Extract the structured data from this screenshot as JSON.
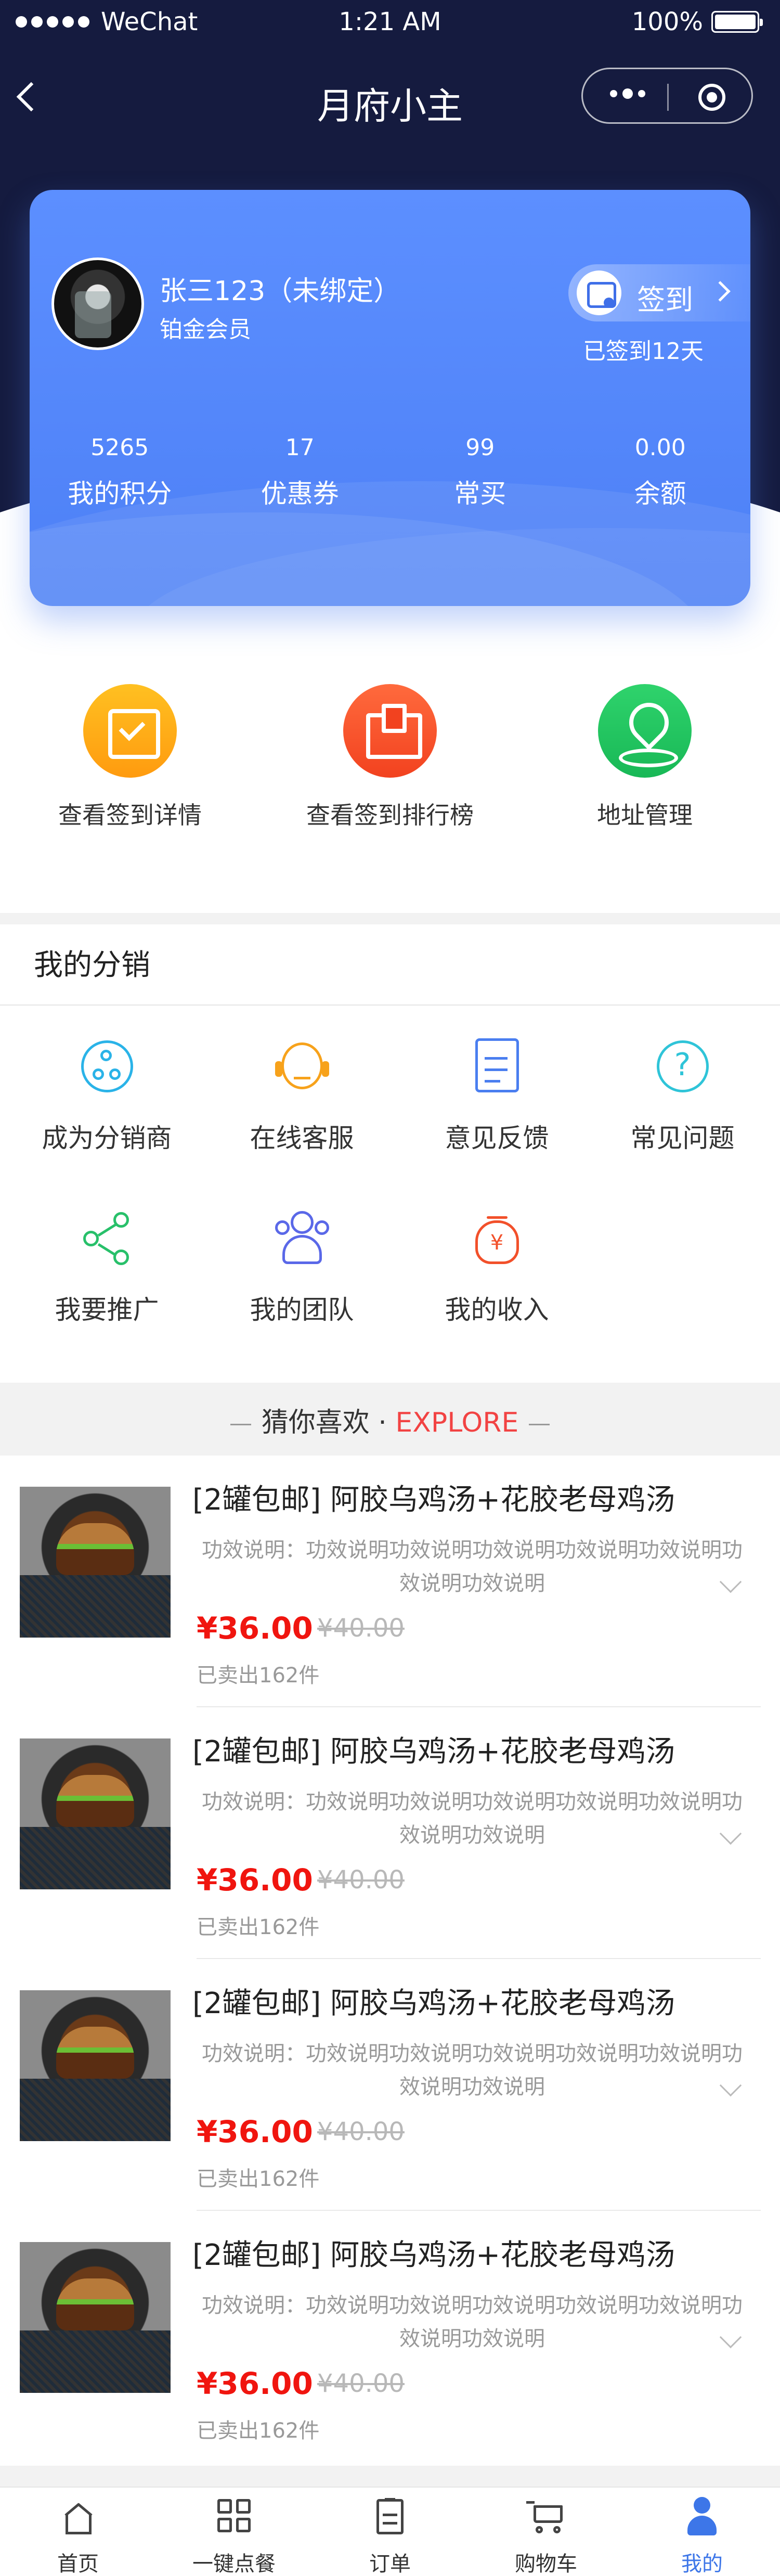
{
  "status_bar": {
    "carrier": "WeChat",
    "time": "1:21 AM",
    "battery": "100%"
  },
  "nav": {
    "title": "月府小主"
  },
  "member_card": {
    "name": "张三123（未绑定）",
    "level": "铂金会员",
    "checkin_label": "签到",
    "checkin_status": "已签到12天",
    "stats": [
      {
        "value": "5265",
        "label": "我的积分"
      },
      {
        "value": "17",
        "label": "优惠券"
      },
      {
        "value": "99",
        "label": "常买"
      },
      {
        "value": "0.00",
        "label": "余额"
      }
    ]
  },
  "shortcuts": [
    {
      "label": "查看签到详情",
      "icon": "calendar-check-icon",
      "color": "#ffb01a"
    },
    {
      "label": "查看签到排行榜",
      "icon": "podium-icon",
      "color": "#f2502a"
    },
    {
      "label": "地址管理",
      "icon": "location-pin-icon",
      "color": "#22c460"
    }
  ],
  "distribution": {
    "title": "我的分销",
    "items": [
      {
        "label": "成为分销商",
        "icon": "network-icon",
        "color": "#2ab3e8"
      },
      {
        "label": "在线客服",
        "icon": "customer-service-icon",
        "color": "#f7a21b"
      },
      {
        "label": "意见反馈",
        "icon": "feedback-icon",
        "color": "#4a7ef0"
      },
      {
        "label": "常见问题",
        "icon": "question-icon",
        "color": "#2fc4d8"
      },
      {
        "label": "我要推广",
        "icon": "share-icon",
        "color": "#28c06a"
      },
      {
        "label": "我的团队",
        "icon": "team-icon",
        "color": "#5a68e8"
      },
      {
        "label": "我的收入",
        "icon": "income-icon",
        "color": "#f2502a"
      }
    ]
  },
  "explore": {
    "cn": "猜你喜欢",
    "dot": "·",
    "en": "EXPLORE"
  },
  "products": [
    {
      "title": "[2罐包邮] 阿胶乌鸡汤+花胶老母鸡汤",
      "desc": "功效说明：功效说明功效说明功效说明功效说明功效说明功效说明功效说明",
      "price": "¥36.00",
      "old_price": "¥40.00",
      "sold": "已卖出162件"
    },
    {
      "title": "[2罐包邮] 阿胶乌鸡汤+花胶老母鸡汤",
      "desc": "功效说明：功效说明功效说明功效说明功效说明功效说明功效说明功效说明",
      "price": "¥36.00",
      "old_price": "¥40.00",
      "sold": "已卖出162件"
    },
    {
      "title": "[2罐包邮] 阿胶乌鸡汤+花胶老母鸡汤",
      "desc": "功效说明：功效说明功效说明功效说明功效说明功效说明功效说明功效说明",
      "price": "¥36.00",
      "old_price": "¥40.00",
      "sold": "已卖出162件"
    },
    {
      "title": "[2罐包邮] 阿胶乌鸡汤+花胶老母鸡汤",
      "desc": "功效说明：功效说明功效说明功效说明功效说明功效说明功效说明功效说明",
      "price": "¥36.00",
      "old_price": "¥40.00",
      "sold": "已卖出162件"
    }
  ],
  "tabbar": [
    {
      "label": "首页",
      "icon": "home-icon"
    },
    {
      "label": "一键点餐",
      "icon": "grid-icon"
    },
    {
      "label": "订单",
      "icon": "clipboard-icon"
    },
    {
      "label": "购物车",
      "icon": "cart-icon"
    },
    {
      "label": "我的",
      "icon": "user-icon",
      "active": true
    }
  ]
}
